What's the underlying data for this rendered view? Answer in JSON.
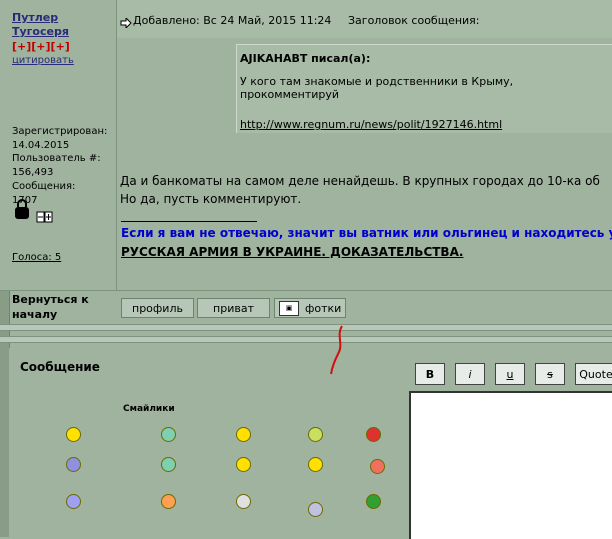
{
  "author": {
    "name_line1": "Путлер",
    "name_line2": "Тугосеря",
    "rating": "[+][+][+]",
    "quote_link": "цитировать",
    "registered_label": "Зарегистрирован:",
    "registered_date": "14.04.2015",
    "user_num_label": "Пользователь #:",
    "user_num": "156,493",
    "messages_label": "Сообщения:",
    "messages": "1707",
    "votes": "Голоса: 5"
  },
  "post": {
    "added": "Добавлено: Вс 24 Май, 2015 11:24",
    "subject_label": "Заголовок сообщения:",
    "quote_author": "AJIKAHABT писал(а):",
    "quote_text": "У кого там знакомые и родственники в Крыму, прокомментируй",
    "quote_link": "http://www.regnum.ru/news/polit/1927146.html",
    "body_line1": "Да и банкоматы на самом деле ненайдешь. В крупных городах до 10-ка об",
    "body_line2": "Но да, пусть комментируют.",
    "sig_line1": "Если я вам не отвечаю, значит вы ватник или ольгинец и находитесь у",
    "sig_line2": "РУССКАЯ АРМИЯ В УКРАИНЕ. ДОКАЗАТЕЛЬСТВА."
  },
  "actions": {
    "back_to_top": "Вернуться к началу",
    "profile": "профиль",
    "private": "приват",
    "photos": "фотки"
  },
  "compose": {
    "message_label": "Сообщение",
    "smilies_label": "Смайлики",
    "bold": "B",
    "italic": "i",
    "underline": "u",
    "strike": "s",
    "quote": "Quote"
  },
  "colors": {
    "background": "#9fb39f",
    "link": "#2a2a7a",
    "signature_blue": "#0000cc",
    "rating_red": "#c00000"
  }
}
